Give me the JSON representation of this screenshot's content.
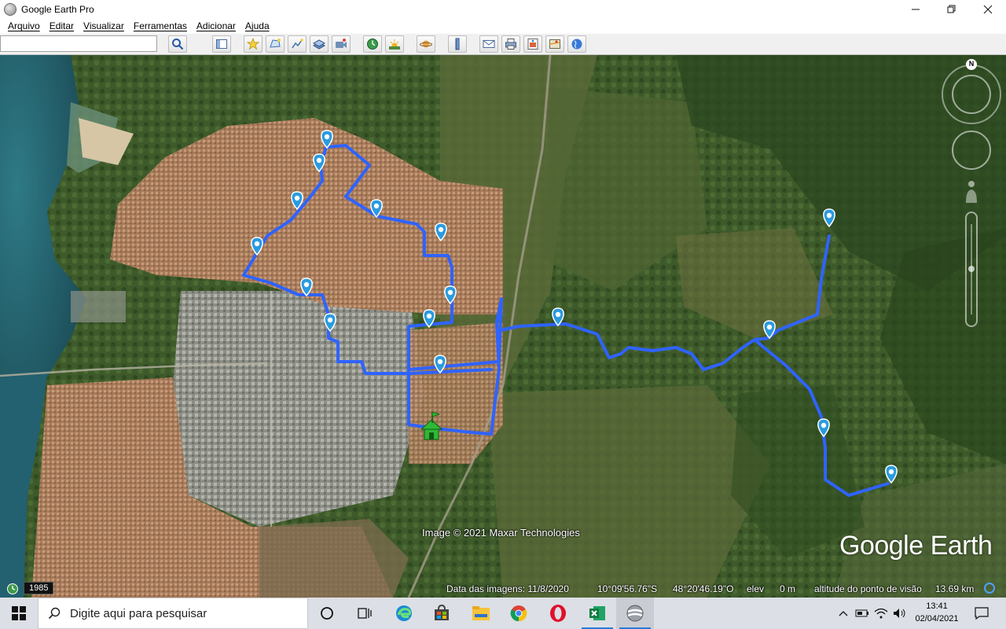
{
  "window": {
    "title": "Google Earth Pro"
  },
  "menu": [
    "Arquivo",
    "Editar",
    "Visualizar",
    "Ferramentas",
    "Adicionar",
    "Ajuda"
  ],
  "search": {
    "value": ""
  },
  "toolbar_icons": [
    "search-icon",
    "sidebar-toggle-icon",
    "add-placemark-icon",
    "add-polygon-icon",
    "add-path-icon",
    "add-image-overlay-icon",
    "record-tour-icon",
    "historical-imagery-icon",
    "sunlight-icon",
    "planets-icon",
    "ruler-icon",
    "email-icon",
    "print-icon",
    "save-image-icon",
    "view-in-maps-icon",
    "earth-icon"
  ],
  "map": {
    "credit": "Image © 2021 Maxar Technologies",
    "logo": "Google Earth",
    "route_color": "#2f63ff",
    "placemark_color": "#2a9be0",
    "compass_label": "N"
  },
  "status": {
    "year": "1985",
    "imagery_date": "Data das imagens: 11/8/2020",
    "latitude": "10°09'56.76\"S",
    "longitude": "48°20'46.19\"O",
    "elevation_label": "elev",
    "elevation_value": "0 m",
    "eye_alt_label": "altitude do ponto de visão",
    "eye_alt_value": "13.69 km"
  },
  "taskbar": {
    "search_placeholder": "Digite aqui para pesquisar",
    "apps": [
      "cortana-icon",
      "task-view-icon",
      "edge-icon",
      "store-icon",
      "file-explorer-icon",
      "chrome-icon",
      "opera-icon",
      "excel-icon",
      "google-earth-icon"
    ],
    "time": "13:41",
    "date": "02/04/2021"
  }
}
